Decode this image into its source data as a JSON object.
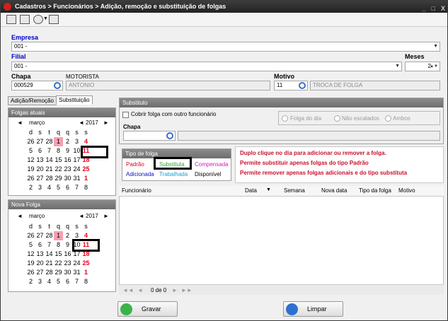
{
  "window": {
    "title": "Cadastros > Funcionários > Adição, remoção e substituição de folgas",
    "min": "_",
    "max": "□",
    "close": "X"
  },
  "toolbar": {
    "icons": [
      "exit-icon",
      "list-icon",
      "search-icon",
      "users-icon"
    ]
  },
  "empresa": {
    "label": "Empresa",
    "value": "001 -"
  },
  "filial": {
    "label": "Filial",
    "value": "001 -"
  },
  "meses": {
    "label": "Meses",
    "value": "2"
  },
  "chapa": {
    "label": "Chapa",
    "value": "000529",
    "name_header": "MOTORISTA",
    "name": "ANTONIO"
  },
  "motivo": {
    "label": "Motivo",
    "value": "11",
    "desc": "TROCA DE FOLGA"
  },
  "tabs": [
    "Adição/Remoção",
    "Substituição"
  ],
  "folgas_atuais": {
    "title": "Folgas atuais",
    "month": "março",
    "year": "2017",
    "prev": "◄",
    "next": "►",
    "weekdays": [
      "d",
      "s",
      "t",
      "q",
      "q",
      "s",
      "s"
    ],
    "days": [
      "26",
      "27",
      "28",
      "1",
      "2",
      "3",
      "4",
      "5",
      "6",
      "7",
      "8",
      "9",
      "10",
      "11",
      "12",
      "13",
      "14",
      "15",
      "16",
      "17",
      "18",
      "19",
      "20",
      "21",
      "22",
      "23",
      "24",
      "25",
      "26",
      "27",
      "28",
      "29",
      "30",
      "31",
      "1",
      "2",
      "3",
      "4",
      "5",
      "6",
      "7",
      "8"
    ]
  },
  "nova_folga": {
    "title": "Nova Folga",
    "month": "março",
    "year": "2017",
    "prev": "◄",
    "next": "►",
    "weekdays": [
      "d",
      "s",
      "t",
      "q",
      "q",
      "s",
      "s"
    ],
    "days": [
      "26",
      "27",
      "28",
      "1",
      "2",
      "3",
      "4",
      "5",
      "6",
      "7",
      "8",
      "9",
      "10",
      "11",
      "12",
      "13",
      "14",
      "15",
      "16",
      "17",
      "18",
      "19",
      "20",
      "21",
      "22",
      "23",
      "24",
      "25",
      "26",
      "27",
      "28",
      "29",
      "30",
      "31",
      "1",
      "2",
      "3",
      "4",
      "5",
      "6",
      "7",
      "8"
    ]
  },
  "substituto": {
    "title": "Substituto",
    "cobrir_label": "Cobrir folga com outro funcionário",
    "chapa_label": "Chapa",
    "radios": [
      "Folga do dia",
      "Não escalados",
      "Ambos"
    ]
  },
  "tipo_folga": {
    "title": "Tipo de folga",
    "items": [
      {
        "label": "Padrão",
        "color": "#e8001c"
      },
      {
        "label": "Substituta",
        "color": "#2eaa2e"
      },
      {
        "label": "Compensada",
        "color": "#d020c8"
      },
      {
        "label": "Adicionada",
        "color": "#1010c0"
      },
      {
        "label": "Trabalhada",
        "color": "#18a0c8"
      },
      {
        "label": "Disponível",
        "color": "#000000"
      }
    ]
  },
  "messages": [
    "Duplo clique no dia para adicionar ou remover a folga.",
    "Permite substituir apenas folgas do tipo Padrão",
    "Permite remover apenas folgas adicionais e do tipo substituta"
  ],
  "grid": {
    "columns": [
      "Funcionário",
      "Data",
      "Semana",
      "Nova data",
      "Tipo da folga",
      "Motivo"
    ],
    "sort_icon": "▼"
  },
  "pager": {
    "first": "◄◄",
    "prev": "◄",
    "text": "0 de 0",
    "next": "►",
    "last": "►►"
  },
  "buttons": {
    "save": "Gravar",
    "clear": "Limpar"
  }
}
